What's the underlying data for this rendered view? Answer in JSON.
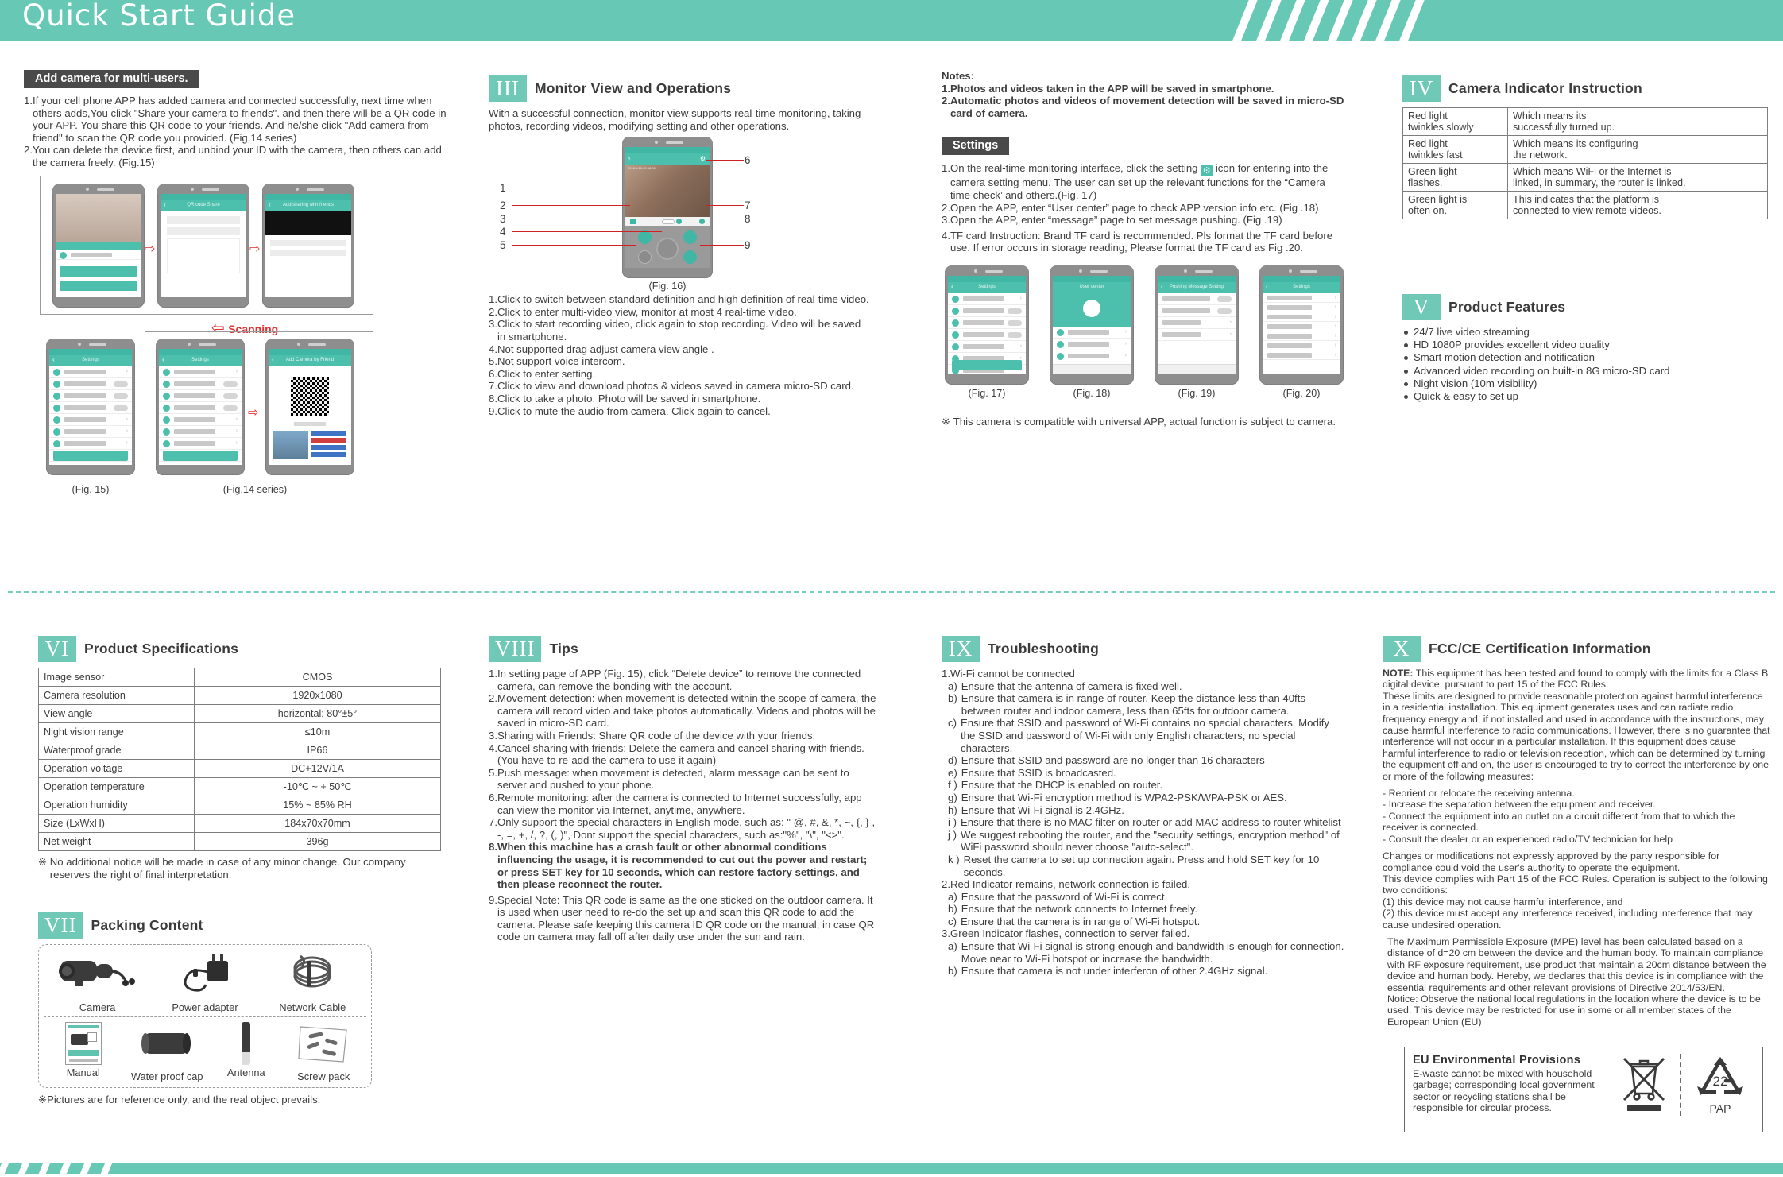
{
  "header": {
    "title": "Quick Start Guide"
  },
  "multiuser": {
    "badge": "Add camera for multi-users.",
    "items": [
      {
        "num": "1.",
        "text": "If your cell phone APP has added camera and connected successfully, next time when others adds,You click \"Share your camera to friends\". and then there will be a QR code in your APP. You share this QR code to your friends. And he/she click \"Add camera from friend\" to scan the QR code you provided. (Fig.14 series)"
      },
      {
        "num": "2.",
        "text": "You can delete the device first, and unbind your ID with the camera, then others can add the camera freely. (Fig.15)"
      }
    ],
    "scanning_label": "Scanning",
    "fig15_caption": "(Fig. 15)",
    "fig14_caption": "(Fig.14 series)"
  },
  "monitor": {
    "roman": "III",
    "title": "Monitor View and Operations",
    "intro": "With a successful connection, monitor view supports real-time monitoring, taking photos, recording videos, modifying setting and other operations.",
    "fig_caption": "(Fig. 16)",
    "callouts": [
      "1",
      "2",
      "3",
      "4",
      "5",
      "6",
      "7",
      "8",
      "9"
    ],
    "items": [
      {
        "num": "1.",
        "text": "Click to switch between standard definition and high definition of real-time video."
      },
      {
        "num": "2.",
        "text": "Click to enter multi-video view, monitor at most 4 real-time video."
      },
      {
        "num": "3.",
        "text": "Click to start recording video, click again to stop recording. Video will be saved in smartphone."
      },
      {
        "num": "4.",
        "text": "Not supported drag adjust camera view angle ."
      },
      {
        "num": "5.",
        "text": "Not support voice intercom."
      },
      {
        "num": "6.",
        "text": "Click to enter setting."
      },
      {
        "num": "7.",
        "text": "Click to view and download photos & videos saved in  camera micro-SD card."
      },
      {
        "num": "8.",
        "text": "Click to take a photo. Photo will be saved in smartphone."
      },
      {
        "num": "9.",
        "text": "Click to mute the audio from camera. Click again to cancel."
      }
    ]
  },
  "notes": {
    "heading": "Notes:",
    "items": [
      {
        "num": "1.",
        "text": "Photos and videos taken in the APP will be saved in smartphone."
      },
      {
        "num": "2.",
        "text": "Automatic photos and videos of movement detection will be saved in micro-SD card of camera."
      }
    ]
  },
  "settings": {
    "badge": "Settings",
    "gear_icon": "gear-icon",
    "items": [
      {
        "num": "1.",
        "pre": "On the real-time monitoring interface, click the setting ",
        "post": " icon for entering into the camera setting menu. The user can set up the relevant functions for the “Camera time check’ and others.(Fig. 17)"
      },
      {
        "num": "2.",
        "text": "Open the APP, enter “User center” page to check APP version info etc. (Fig .18)"
      },
      {
        "num": "3.",
        "text": "Open the APP, enter “message” page to set message pushing. (Fig .19)"
      },
      {
        "num": "4.",
        "text": "TF card Instruction: Brand TF card is recommended. Pls format the TF card before use. If error occurs in storage reading, Please format the TF card as Fig .20."
      }
    ],
    "fig_captions": [
      "(Fig. 17)",
      "(Fig. 18)",
      "(Fig. 19)",
      "(Fig. 20)"
    ],
    "footnote": "This camera is compatible with universal APP, actual function is subject to camera."
  },
  "indicator": {
    "roman": "IV",
    "title": "Camera Indicator Instruction",
    "rows": [
      {
        "state": "Red light\ntwinkles slowly",
        "meaning": "Which means its\nsuccessfully turned up."
      },
      {
        "state": "Red light\ntwinkles fast",
        "meaning": "Which means its configuring\nthe network."
      },
      {
        "state": "Green light\nflashes.",
        "meaning": "Which means WiFi or the Internet is\nlinked, in summary, the router is linked."
      },
      {
        "state": "Green light is\noften on.",
        "meaning": "This indicates that the platform is\nconnected to view remote videos."
      }
    ]
  },
  "features": {
    "roman": "V",
    "title": "Product Features",
    "items": [
      "24/7 live video streaming",
      "HD 1080P provides excellent video quality",
      "Smart motion detection and notification",
      "Advanced video recording on built-in 8G micro-SD card",
      "Night vision (10m visibility)",
      "Quick & easy to set up"
    ]
  },
  "specs": {
    "roman": "VI",
    "title": "Product Specifications",
    "rows": [
      {
        "k": "Image sensor",
        "v": "CMOS"
      },
      {
        "k": "Camera resolution",
        "v": "1920x1080"
      },
      {
        "k": "View angle",
        "v": "horizontal: 80°±5°"
      },
      {
        "k": "Night vision range",
        "v": "≤10m"
      },
      {
        "k": "Waterproof grade",
        "v": "IP66"
      },
      {
        "k": "Operation voltage",
        "v": "DC+12V/1A"
      },
      {
        "k": "Operation temperature",
        "v": "-10℃ ~ + 50℃"
      },
      {
        "k": "Operation humidity",
        "v": "15% ~ 85% RH"
      },
      {
        "k": "Size (LxWxH)",
        "v": "184x70x70mm"
      },
      {
        "k": "Net weight",
        "v": "396g"
      }
    ],
    "footnote": "No additional notice will be made in case of any minor change. Our company reserves the right of final interpretation."
  },
  "packing": {
    "roman": "VII",
    "title": "Packing Content",
    "row1": [
      {
        "name": "Camera",
        "icon": "camera-icon"
      },
      {
        "name": "Power adapter",
        "icon": "power-adapter-icon"
      },
      {
        "name": "Network Cable",
        "icon": "network-cable-icon"
      }
    ],
    "row2": [
      {
        "name": "Manual",
        "icon": "manual-icon"
      },
      {
        "name": "Water proof cap",
        "icon": "waterproof-cap-icon"
      },
      {
        "name": "Antenna",
        "icon": "antenna-icon"
      },
      {
        "name": "Screw pack",
        "icon": "screw-pack-icon"
      }
    ],
    "footnote": "Pictures are for reference only, and the real object prevails."
  },
  "tips": {
    "roman": "VIII",
    "title": "Tips",
    "items": [
      {
        "num": "1.",
        "text": "In setting page of APP (Fig. 15), click “Delete device” to remove the connected camera, can remove the bonding with the account.",
        "bold": false
      },
      {
        "num": "2.",
        "text": "Movement detection: when movement is detected within the scope of camera, the camera will record video and take photos automatically. Videos and photos will be saved in micro-SD card.",
        "bold": false
      },
      {
        "num": "3.",
        "text": "Sharing with Friends: Share QR code of the device with your friends.",
        "bold": false
      },
      {
        "num": "4.",
        "text": "Cancel sharing with friends: Delete the camera and cancel sharing with friends. (You have to re-add the camera to use it again)",
        "bold": false
      },
      {
        "num": "5.",
        "text": "Push message: when movement is detected, alarm message can be sent to server and pushed to your phone.",
        "bold": false
      },
      {
        "num": "6.",
        "text": "Remote monitoring: after the camera is connected to Internet successfully, app can view the monitor via Internet, anytime, anywhere.",
        "bold": false
      },
      {
        "num": "7.",
        "text": "Only support the special characters in English mode,   such as: \" @, #, &, *,   ~,  {, }  , -, =, +, /, ?, (, )\",    Dont support the special characters, such as:\"%\", \"\\\",  \"<>\".",
        "bold": false
      },
      {
        "num": "8.",
        "text": "When this machine has a crash fault or other abnormal conditions influencing the usage, it is recommended to cut out the power and restart; or press SET key for 10 seconds, which can restore factory settings, and then please reconnect the router.",
        "bold": true
      },
      {
        "num": "9.",
        "text": "Special Note:  This QR code is same as the one sticked on the outdoor camera.  It is used when user need to re-do the set up and scan this QR code to add the camera. Please safe keeping this camera ID QR code on the manual, in case QR code on camera may fall off after daily use under the sun and rain.",
        "bold": false
      }
    ]
  },
  "troubleshooting": {
    "roman": "IX",
    "title": "Troubleshooting",
    "groups": [
      {
        "num": "1.",
        "title": "Wi-Fi cannot be connected",
        "items": [
          {
            "key": "a)",
            "text": "Ensure that the antenna of camera is fixed well."
          },
          {
            "key": "b)",
            "text": "Ensure that camera is in range of router. Keep the distance less than 40fts between router and indoor camera, less than 65fts for outdoor camera."
          },
          {
            "key": "c)",
            "text": "Ensure that SSID and password of Wi-Fi contains no special characters. Modify the SSID and password of Wi-Fi with only English characters, no special characters."
          },
          {
            "key": "d)",
            "text": "Ensure that SSID and password are no longer than 16 characters"
          },
          {
            "key": "e)",
            "text": "Ensure that SSID is broadcasted."
          },
          {
            "key": "f )",
            "text": "Ensure that the DHCP is enabled on router."
          },
          {
            "key": "g)",
            "text": "Ensure that Wi-Fi encryption method is WPA2-PSK/WPA-PSK or AES."
          },
          {
            "key": "h)",
            "text": "Ensure that Wi-Fi signal is 2.4GHz."
          },
          {
            "key": "i )",
            "text": "Ensure that there is no MAC filter on router or add MAC address to router whitelist"
          },
          {
            "key": "j )",
            "text": "We suggest rebooting the router, and the \"security settings, encryption method\" of WiFi password should never choose \"auto-select\"."
          },
          {
            "key": "k )",
            "text": "Reset the camera to set up connection again. Press and hold SET key for 10 seconds."
          }
        ]
      },
      {
        "num": "2.",
        "title": "Red Indicator remains, network connection is failed.",
        "items": [
          {
            "key": "a)",
            "text": "Ensure that the password of Wi-Fi is correct."
          },
          {
            "key": "b)",
            "text": "Ensure that the network connects to Internet freely."
          },
          {
            "key": "c)",
            "text": "Ensure that the camera is in range of Wi-Fi hotspot."
          }
        ]
      },
      {
        "num": "3.",
        "title": "Green Indicator flashes, connection to server failed.",
        "items": [
          {
            "key": "a)",
            "text": "Ensure that Wi-Fi signal is strong enough and bandwidth is enough for connection. Move near to Wi-Fi hotspot or increase the bandwidth."
          },
          {
            "key": "b)",
            "text": "Ensure that camera is not under interferon of other 2.4GHz signal."
          }
        ]
      }
    ]
  },
  "fcc": {
    "roman": "X",
    "title": "FCC/CE Certification Information",
    "note_label": "NOTE:",
    "note_text": " This equipment has been tested and found to comply with the limits for a Class B digital device, pursuant to part 15 of the FCC Rules.",
    "para1": "These limits are designed to provide reasonable protection against harmful interference in a residential installation. This equipment generates uses and can radiate radio frequency energy and, if not installed and used in accordance with the instructions, may cause harmful  interference to radio communications. However, there is no guarantee that interference will not occur in a particular installation. If this equipment does cause harmful interference to radio or television reception, which can be determined by turning the equipment off and on, the user is encouraged to try to correct the interference by one or more of the following measures:",
    "measures": [
      "- Reorient or relocate the receiving antenna.",
      "- Increase the separation between the equipment and receiver.",
      "- Connect the equipment into an outlet on a circuit different from that to which the receiver is connected.",
      "- Consult the dealer or an experienced radio/TV technician for help"
    ],
    "para2": "Changes or modifications not expressly approved by the party responsible for compliance could void the user's authority to operate the equipment.\nThis device complies with Part 15 of the FCC Rules. Operation is subject to the following two  conditions:\n(1) this device may not cause harmful interference, and\n(2) this device must accept any interference received, including interference that may      cause undesired operation.",
    "para3": "The Maximum Permissible Exposure (MPE) level has been calculated based on a distance of d=20 cm between the device and the human body. To maintain compliance with RF exposure requirement, use product that maintain a 20cm distance between the device and human body. Hereby, we declares that this device is in compliance with the essential requirements and other relevant provisions of Directive 2014/53/EN.\nNotice: Observe the national local regulations in the location where the device is to be used. This device may be restricted for use in some or all member states of the European Union (EU)"
  },
  "eu": {
    "title": "EU Environmental Provisions",
    "text": "E-waste cannot be mixed with household garbage; corresponding local government sector or recycling stations shall be responsible for circular process.",
    "wheelie_bin_icon": "crossed-wheelie-bin-icon",
    "recycle_code": "22",
    "recycle_label": "PAP"
  }
}
